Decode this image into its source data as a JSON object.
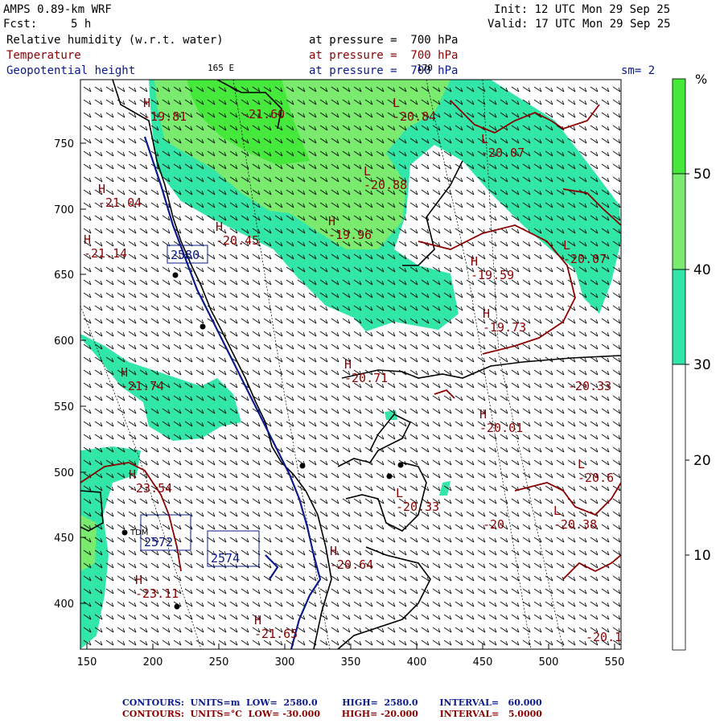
{
  "header": {
    "model": "AMPS 0.89-km WRF",
    "fcst_label": "Fcst:",
    "fcst_value": "5 h",
    "init": "Init: 12 UTC Mon 29 Sep 25",
    "valid": "Valid: 17 UTC Mon 29 Sep 25",
    "field1_name": "Relative humidity (w.r.t. water)",
    "field1_level": "at pressure =  700 hPa",
    "field2_name": "Temperature",
    "field2_level": "at pressure =  700 hPa",
    "field3_name": "Geopotential height",
    "field3_level": "at pressure =  700 hPa",
    "lon_label_1": "165 E",
    "lon_label_2": "170",
    "smoothing": "sm= 2"
  },
  "axes": {
    "x_ticks": [
      "150",
      "200",
      "250",
      "300",
      "350",
      "400",
      "450",
      "500",
      "550"
    ],
    "y_ticks": [
      "750",
      "700",
      "650",
      "600",
      "550",
      "500",
      "450",
      "400"
    ]
  },
  "colorbar": {
    "unit": "%",
    "ticks": [
      "50",
      "40",
      "30",
      "20",
      "10"
    ],
    "levels": [
      {
        "range": "50+",
        "color": "#46e83c"
      },
      {
        "range": "40-50",
        "color": "#7aeb6e"
      },
      {
        "range": "30-40",
        "color": "#32e6a8"
      },
      {
        "range": "<30",
        "color": "#ffffff"
      }
    ]
  },
  "map_labels": {
    "temperature": [
      {
        "mark": "H",
        "value": "-19.81"
      },
      {
        "mark": "",
        "value": "-21.60"
      },
      {
        "mark": "L",
        "value": "-20.84"
      },
      {
        "mark": "L",
        "value": "-20.07"
      },
      {
        "mark": "L",
        "value": "-20.88"
      },
      {
        "mark": "H",
        "value": "-21.04"
      },
      {
        "mark": "H",
        "value": "-19.96"
      },
      {
        "mark": "H",
        "value": "-20.45"
      },
      {
        "mark": "H",
        "value": "-21.14"
      },
      {
        "mark": "L",
        "value": "-20.07"
      },
      {
        "mark": "H",
        "value": "-19.59"
      },
      {
        "mark": "H",
        "value": "-19.73"
      },
      {
        "mark": "H",
        "value": "-20.71"
      },
      {
        "mark": "",
        "value": "-20.33"
      },
      {
        "mark": "H",
        "value": "-21.74"
      },
      {
        "mark": "H",
        "value": "-20.01"
      },
      {
        "mark": "L",
        "value": "-20.6"
      },
      {
        "mark": "H",
        "value": "-23.54"
      },
      {
        "mark": "L",
        "value": "-20.33"
      },
      {
        "mark": "",
        "value": "-20"
      },
      {
        "mark": "L",
        "value": "-20.38"
      },
      {
        "mark": "H",
        "value": "-20.64"
      },
      {
        "mark": "H",
        "value": "-23.11"
      },
      {
        "mark": "",
        "value": "-20.1"
      },
      {
        "mark": "H",
        "value": "-21.65"
      }
    ],
    "height": [
      {
        "value": "2580"
      },
      {
        "value": "2572"
      },
      {
        "value": "2574"
      }
    ],
    "station": "TDM"
  },
  "footer": {
    "line1": "CONTOURS:  UNITS=m  LOW=  2580.0        HIGH=  2580.0       INTERVAL=   60.000",
    "line2": "CONTOURS:  UNITS=°C  LOW= -30.000       HIGH= -20.000       INTERVAL=   5.0000",
    "color1": "#0a1a8a",
    "color2": "#8b0000"
  }
}
